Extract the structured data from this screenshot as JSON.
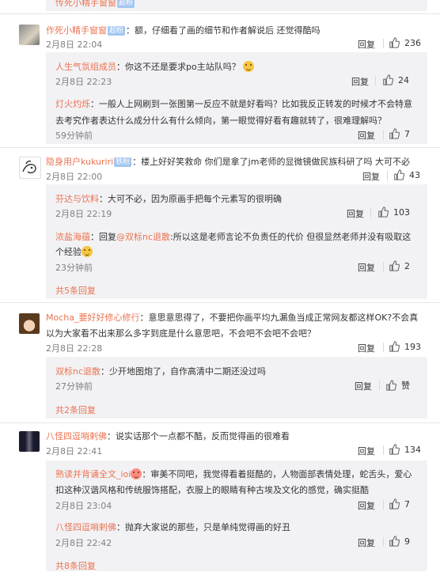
{
  "labels": {
    "reply": "回复",
    "like": "赞"
  },
  "top": {
    "name": "传死小精手窗窗",
    "tag": "超粉"
  },
  "c1": {
    "name": "作死小精手窗窗",
    "tag": "超粉",
    "text": "：额，仔细看了画的细节和作者解说后 还觉得酷吗",
    "time": "2月8日 22:04",
    "likes": "236"
  },
  "r1a": {
    "name": "人生气氛组成员",
    "text": "：你这不还是要求po主站队吗？",
    "time": "2月8日 22:23",
    "likes": "24"
  },
  "r1b": {
    "name": "灯火灼烁",
    "text1": "：一般人上网刷到一张图第一反应不就是好看吗？比如我反正转发的时候才不会特意",
    "text2": "去考究作者表达什么成分什么有什么倾向，第一眼觉得好看有趣就转了，很难理解吗？",
    "time": "59分钟前",
    "likes": "7"
  },
  "c2": {
    "name": "隐身用户kukuriri",
    "tag": "铁粉",
    "text": "：楼上好好笑救命 你们是拿了jm老师的显微镜做民族科研了吗 大可不必",
    "time": "2月8日 22:00",
    "likes": "43"
  },
  "r2a": {
    "name": "芬达与饮料",
    "text": "：大可不必，因为原画手把每个元素写的很明确",
    "time": "2月8日 22:19",
    "likes": "103"
  },
  "r2b": {
    "name": "浓盐海蕴",
    "text1": "：回复",
    "mention": "@双标nc退散",
    "text2": ":所以这是老师言论不负责任的代价 但很显然老师并没有吸取这",
    "text3": "个经验",
    "time": "23分钟前",
    "likes": "2"
  },
  "more2": "共5条回复",
  "c3": {
    "name": "Mocha_要好好修心修行",
    "text1": "：意思意思得了，不要把你画平均九漏鱼当成正常网友都这样OK?不会真",
    "text2": "以为大家看不出来那么多字到底是什么意思吧，不会吧不会吧不会吧？",
    "time": "2月8日 22:28",
    "likes": "193"
  },
  "r3a": {
    "name": "双标nc退散",
    "text": "：少开地图炮了，自作高清中二期还没过吗",
    "time": "27分钟前",
    "likes": "赞"
  },
  "more3": "共2条回复",
  "c4": {
    "name": "八怪四逗哨剌佛",
    "text": "：说实话那个一点都不酷，反而觉得画的很难看",
    "time": "2月8日 22:41",
    "likes": "134"
  },
  "r4a": {
    "name": "熟读并背诵全文_ioi",
    "text1": "：审美不同吧，我觉得看着挺酷的，人物面部表情处理，蛇舌头，爱心",
    "text2": "扣这种汉谐风格和传统服饰搭配，衣服上的眼睛有种古埃及文化的感觉，确实挺酷",
    "time": "2月8日 23:04",
    "likes": "7"
  },
  "r4b": {
    "name": "八怪四逗哨剌佛",
    "text": "：抛弃大家说的那些，只是单纯觉得画的好丑",
    "time": "2月8日 22:42",
    "likes": "9"
  },
  "more4": "共8条回复"
}
